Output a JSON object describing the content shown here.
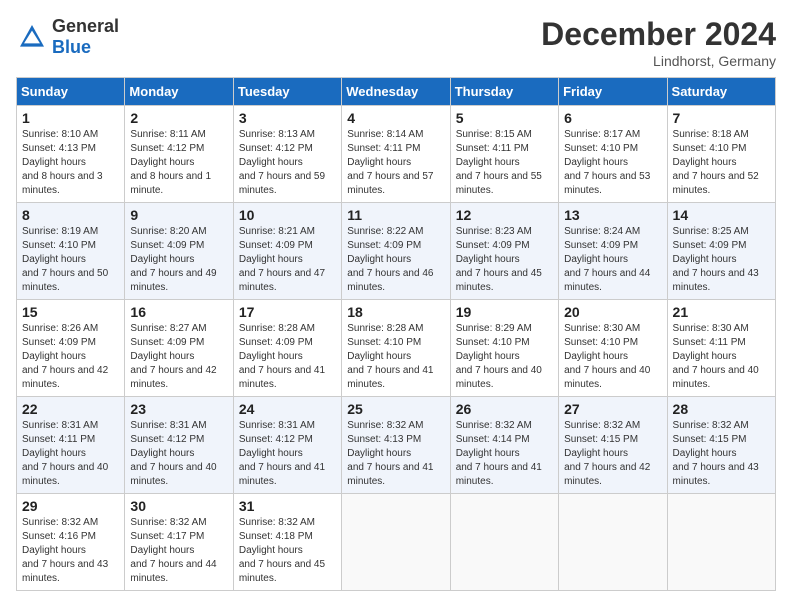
{
  "logo": {
    "general": "General",
    "blue": "Blue"
  },
  "title": "December 2024",
  "location": "Lindhorst, Germany",
  "days_header": [
    "Sunday",
    "Monday",
    "Tuesday",
    "Wednesday",
    "Thursday",
    "Friday",
    "Saturday"
  ],
  "weeks": [
    [
      {
        "day": "1",
        "sunrise": "8:10 AM",
        "sunset": "4:13 PM",
        "daylight": "8 hours and 3 minutes."
      },
      {
        "day": "2",
        "sunrise": "8:11 AM",
        "sunset": "4:12 PM",
        "daylight": "8 hours and 1 minute."
      },
      {
        "day": "3",
        "sunrise": "8:13 AM",
        "sunset": "4:12 PM",
        "daylight": "7 hours and 59 minutes."
      },
      {
        "day": "4",
        "sunrise": "8:14 AM",
        "sunset": "4:11 PM",
        "daylight": "7 hours and 57 minutes."
      },
      {
        "day": "5",
        "sunrise": "8:15 AM",
        "sunset": "4:11 PM",
        "daylight": "7 hours and 55 minutes."
      },
      {
        "day": "6",
        "sunrise": "8:17 AM",
        "sunset": "4:10 PM",
        "daylight": "7 hours and 53 minutes."
      },
      {
        "day": "7",
        "sunrise": "8:18 AM",
        "sunset": "4:10 PM",
        "daylight": "7 hours and 52 minutes."
      }
    ],
    [
      {
        "day": "8",
        "sunrise": "8:19 AM",
        "sunset": "4:10 PM",
        "daylight": "7 hours and 50 minutes."
      },
      {
        "day": "9",
        "sunrise": "8:20 AM",
        "sunset": "4:09 PM",
        "daylight": "7 hours and 49 minutes."
      },
      {
        "day": "10",
        "sunrise": "8:21 AM",
        "sunset": "4:09 PM",
        "daylight": "7 hours and 47 minutes."
      },
      {
        "day": "11",
        "sunrise": "8:22 AM",
        "sunset": "4:09 PM",
        "daylight": "7 hours and 46 minutes."
      },
      {
        "day": "12",
        "sunrise": "8:23 AM",
        "sunset": "4:09 PM",
        "daylight": "7 hours and 45 minutes."
      },
      {
        "day": "13",
        "sunrise": "8:24 AM",
        "sunset": "4:09 PM",
        "daylight": "7 hours and 44 minutes."
      },
      {
        "day": "14",
        "sunrise": "8:25 AM",
        "sunset": "4:09 PM",
        "daylight": "7 hours and 43 minutes."
      }
    ],
    [
      {
        "day": "15",
        "sunrise": "8:26 AM",
        "sunset": "4:09 PM",
        "daylight": "7 hours and 42 minutes."
      },
      {
        "day": "16",
        "sunrise": "8:27 AM",
        "sunset": "4:09 PM",
        "daylight": "7 hours and 42 minutes."
      },
      {
        "day": "17",
        "sunrise": "8:28 AM",
        "sunset": "4:09 PM",
        "daylight": "7 hours and 41 minutes."
      },
      {
        "day": "18",
        "sunrise": "8:28 AM",
        "sunset": "4:10 PM",
        "daylight": "7 hours and 41 minutes."
      },
      {
        "day": "19",
        "sunrise": "8:29 AM",
        "sunset": "4:10 PM",
        "daylight": "7 hours and 40 minutes."
      },
      {
        "day": "20",
        "sunrise": "8:30 AM",
        "sunset": "4:10 PM",
        "daylight": "7 hours and 40 minutes."
      },
      {
        "day": "21",
        "sunrise": "8:30 AM",
        "sunset": "4:11 PM",
        "daylight": "7 hours and 40 minutes."
      }
    ],
    [
      {
        "day": "22",
        "sunrise": "8:31 AM",
        "sunset": "4:11 PM",
        "daylight": "7 hours and 40 minutes."
      },
      {
        "day": "23",
        "sunrise": "8:31 AM",
        "sunset": "4:12 PM",
        "daylight": "7 hours and 40 minutes."
      },
      {
        "day": "24",
        "sunrise": "8:31 AM",
        "sunset": "4:12 PM",
        "daylight": "7 hours and 41 minutes."
      },
      {
        "day": "25",
        "sunrise": "8:32 AM",
        "sunset": "4:13 PM",
        "daylight": "7 hours and 41 minutes."
      },
      {
        "day": "26",
        "sunrise": "8:32 AM",
        "sunset": "4:14 PM",
        "daylight": "7 hours and 41 minutes."
      },
      {
        "day": "27",
        "sunrise": "8:32 AM",
        "sunset": "4:15 PM",
        "daylight": "7 hours and 42 minutes."
      },
      {
        "day": "28",
        "sunrise": "8:32 AM",
        "sunset": "4:15 PM",
        "daylight": "7 hours and 43 minutes."
      }
    ],
    [
      {
        "day": "29",
        "sunrise": "8:32 AM",
        "sunset": "4:16 PM",
        "daylight": "7 hours and 43 minutes."
      },
      {
        "day": "30",
        "sunrise": "8:32 AM",
        "sunset": "4:17 PM",
        "daylight": "7 hours and 44 minutes."
      },
      {
        "day": "31",
        "sunrise": "8:32 AM",
        "sunset": "4:18 PM",
        "daylight": "7 hours and 45 minutes."
      },
      null,
      null,
      null,
      null
    ]
  ]
}
